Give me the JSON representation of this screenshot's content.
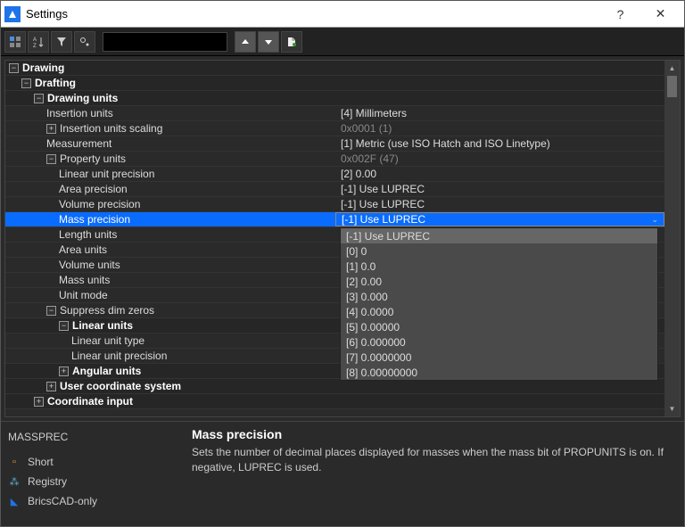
{
  "window": {
    "title": "Settings"
  },
  "tree": {
    "drawing": "Drawing",
    "drafting": "Drafting",
    "drawing_units": "Drawing units",
    "insertion_units": {
      "label": "Insertion units",
      "value": "[4] Millimeters"
    },
    "insertion_scaling": {
      "label": "Insertion units scaling",
      "value": "0x0001 (1)"
    },
    "measurement": {
      "label": "Measurement",
      "value": "[1] Metric (use ISO Hatch and ISO Linetype)"
    },
    "property_units": {
      "label": "Property units",
      "value": "0x002F (47)"
    },
    "linear_prec": {
      "label": "Linear unit precision",
      "value": "[2] 0.00"
    },
    "area_prec": {
      "label": "Area precision",
      "value": "[-1] Use LUPREC"
    },
    "volume_prec": {
      "label": "Volume precision",
      "value": "[-1] Use LUPREC"
    },
    "mass_prec": {
      "label": "Mass precision",
      "value": "[-1] Use LUPREC"
    },
    "length_units": {
      "label": "Length units"
    },
    "area_units": {
      "label": "Area units"
    },
    "volume_units": {
      "label": "Volume units"
    },
    "mass_units": {
      "label": "Mass units"
    },
    "unit_mode": {
      "label": "Unit mode"
    },
    "suppress_dim": "Suppress dim zeros",
    "linear_units_h": "Linear units",
    "linear_unit_type": "Linear unit type",
    "linear_unit_prec": "Linear unit precision",
    "angular_units": "Angular units",
    "ucs": "User coordinate system",
    "coord_input": "Coordinate input"
  },
  "dropdown": [
    "[-1] Use LUPREC",
    "[0] 0",
    "[1] 0.0",
    "[2] 0.00",
    "[3] 0.000",
    "[4] 0.0000",
    "[5] 0.00000",
    "[6] 0.000000",
    "[7] 0.0000000",
    "[8] 0.00000000"
  ],
  "footer": {
    "sysvar": "MASSPREC",
    "short": "Short",
    "registry": "Registry",
    "bricscad": "BricsCAD-only",
    "title": "Mass precision",
    "desc": "Sets the number of decimal places displayed for masses when the mass bit of PROPUNITS is on. If negative, LUPREC is used."
  }
}
